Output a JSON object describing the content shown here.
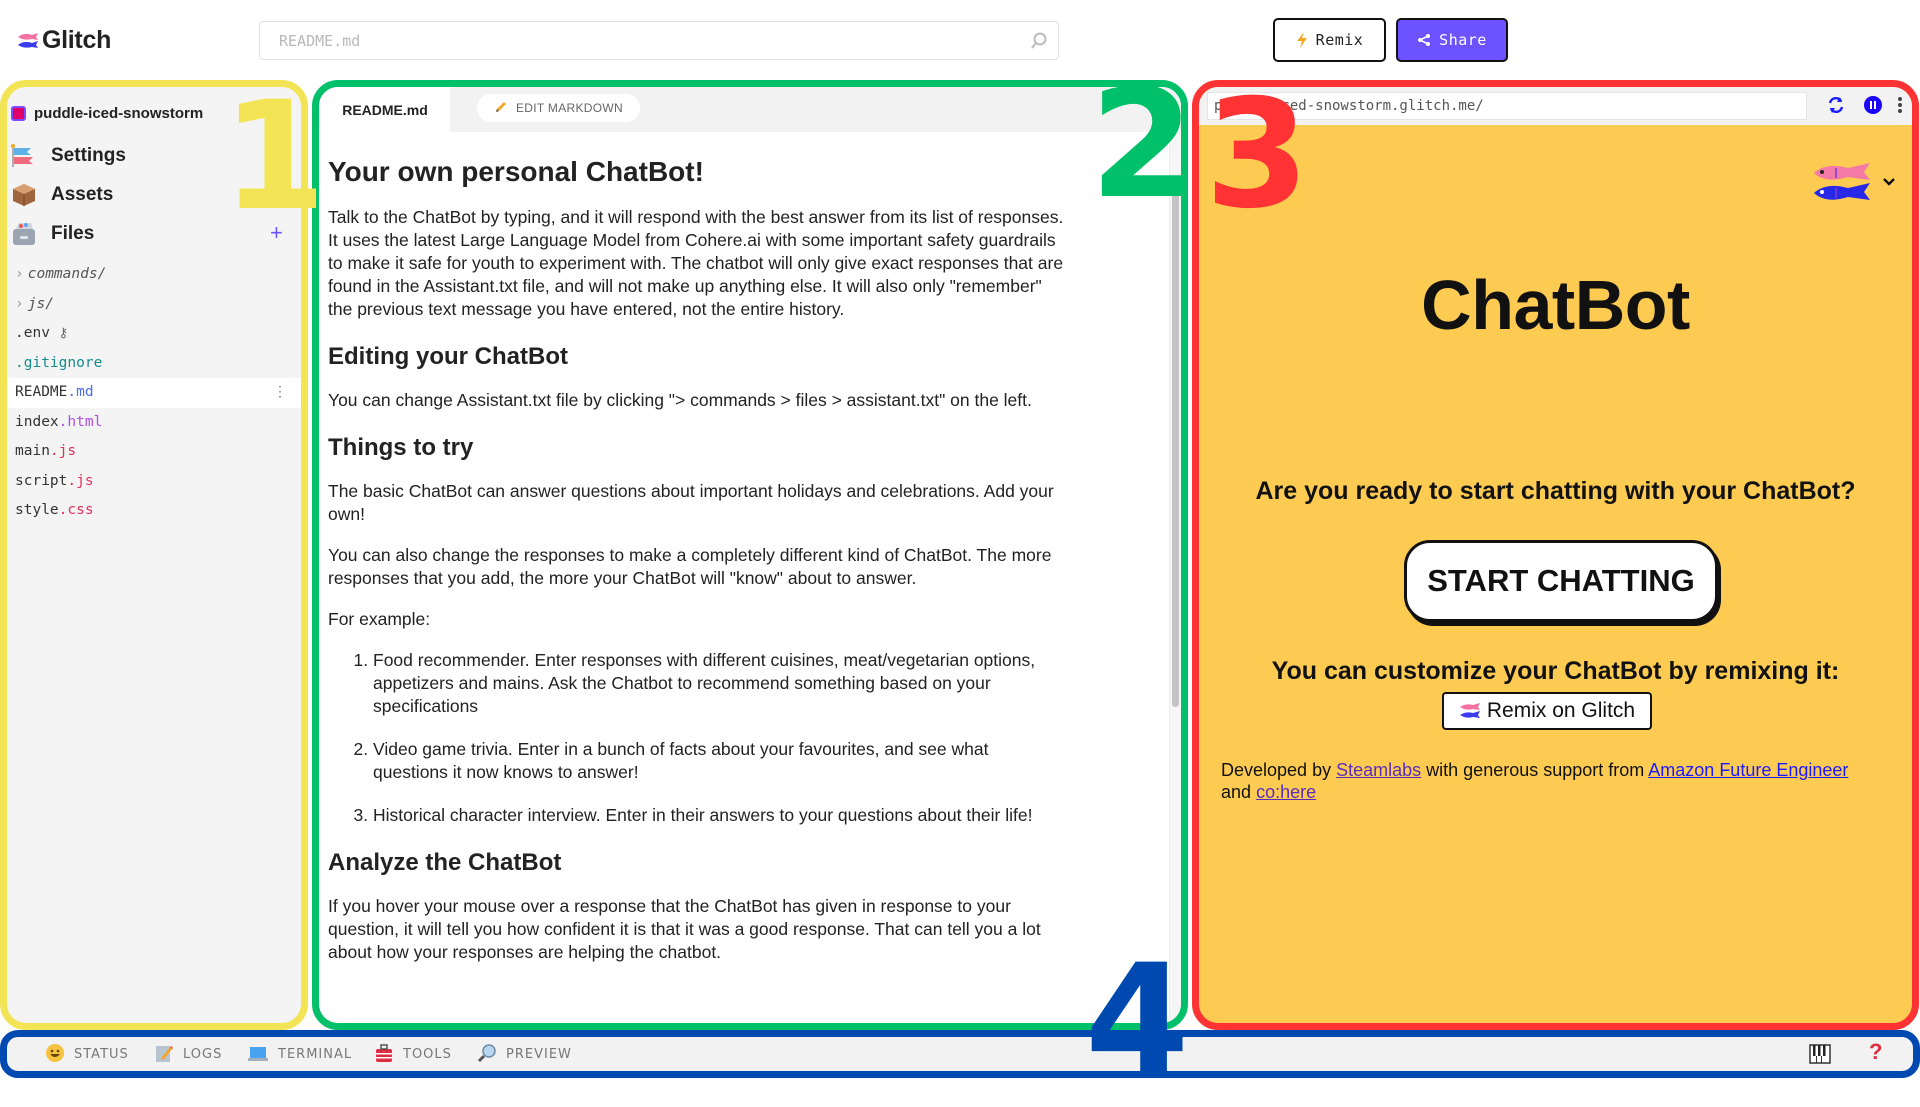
{
  "header": {
    "app_name": "Glitch",
    "search_placeholder": "README.md",
    "remix_label": "Remix",
    "share_label": "Share",
    "colors": {
      "share": "#6d52ff",
      "remix_bolt": "#f5a623"
    }
  },
  "sidebar": {
    "project_name": "puddle-iced-snowstorm",
    "nav": [
      {
        "label": "Settings",
        "icon": "carp-streamer-icon"
      },
      {
        "label": "Assets",
        "icon": "package-icon"
      },
      {
        "label": "Files",
        "icon": "file-cabinet-icon"
      }
    ],
    "files": [
      {
        "name": "commands/",
        "type": "folder"
      },
      {
        "name": "js/",
        "type": "folder"
      },
      {
        "name": ".env",
        "type": "file",
        "suffix_icon": "key-icon"
      },
      {
        "name": ".gitignore",
        "type": "file"
      },
      {
        "base": "README",
        "ext": ".md",
        "type": "file",
        "active": true
      },
      {
        "base": "index",
        "ext": ".html",
        "type": "file"
      },
      {
        "base": "main",
        "ext": ".js",
        "type": "file"
      },
      {
        "base": "script",
        "ext": ".js",
        "type": "file"
      },
      {
        "base": "style",
        "ext": ".css",
        "type": "file"
      }
    ]
  },
  "editor": {
    "tab_label": "README.md",
    "edit_button_label": "EDIT MARKDOWN",
    "content": {
      "h1": "Your own personal ChatBot!",
      "intro": "Talk to the ChatBot by typing, and it will respond with the best answer from its list of responses. It uses the latest Large Language Model from Cohere.ai with some important safety guardrails to make it safe for youth to experiment with. The chatbot will only give exact responses that are found in the Assistant.txt file, and will not make up anything else. It will also only \"remember\" the previous text message you have entered, not the entire history.",
      "h2_editing": "Editing your ChatBot",
      "editing_p": "You can change Assistant.txt file by clicking \"> commands > files > assistant.txt\" on the left.",
      "h2_things": "Things to try",
      "things_p1": "The basic ChatBot can answer questions about important holidays and celebrations. Add your own!",
      "things_p2": "You can also change the responses to make a completely different kind of ChatBot. The more responses that you add, the more your ChatBot will \"know\" about to answer.",
      "for_example": "For example:",
      "examples": [
        "Food recommender. Enter responses with different cuisines, meat/vegetarian options, appetizers and mains. Ask the Chatbot to recommend something based on your specifications",
        "Video game trivia. Enter in a bunch of facts about your favourites, and see what questions it now knows to answer!",
        "Historical character interview. Enter in their answers to your questions about their life!"
      ],
      "h2_analyze": "Analyze the ChatBot",
      "analyze_p": "If you hover your mouse over a response that the ChatBot has given in response to your question, it will tell you how confident it is that it was a good response. That can tell you a lot about how your responses are helping the chatbot."
    }
  },
  "preview": {
    "url": "puddle-iced-snowstorm.glitch.me/",
    "title": "ChatBot",
    "question": "Are you ready to start chatting with your ChatBot?",
    "start_button": "START CHATTING",
    "customize_text": "You can customize your ChatBot by remixing it:",
    "remix_on_glitch": "Remix on Glitch",
    "credits": {
      "prefix": "Developed by",
      "link1": "Steamlabs",
      "middle": "with generous support from",
      "link2": "Amazon Future Engineer",
      "and": "and",
      "link3": "co:here"
    },
    "colors": {
      "background": "#fecb52"
    }
  },
  "bottombar": {
    "items": [
      {
        "label": "STATUS",
        "icon": "smiley-icon"
      },
      {
        "label": "LOGS",
        "icon": "memo-icon"
      },
      {
        "label": "TERMINAL",
        "icon": "laptop-icon"
      },
      {
        "label": "TOOLS",
        "icon": "toolbox-icon"
      },
      {
        "label": "PREVIEW",
        "icon": "magnifier-icon"
      }
    ]
  },
  "annotations": {
    "labels": [
      "1",
      "2",
      "3",
      "4"
    ],
    "colors": [
      "#f2e455",
      "#00c06a",
      "#ff3333",
      "#0049b0"
    ]
  }
}
